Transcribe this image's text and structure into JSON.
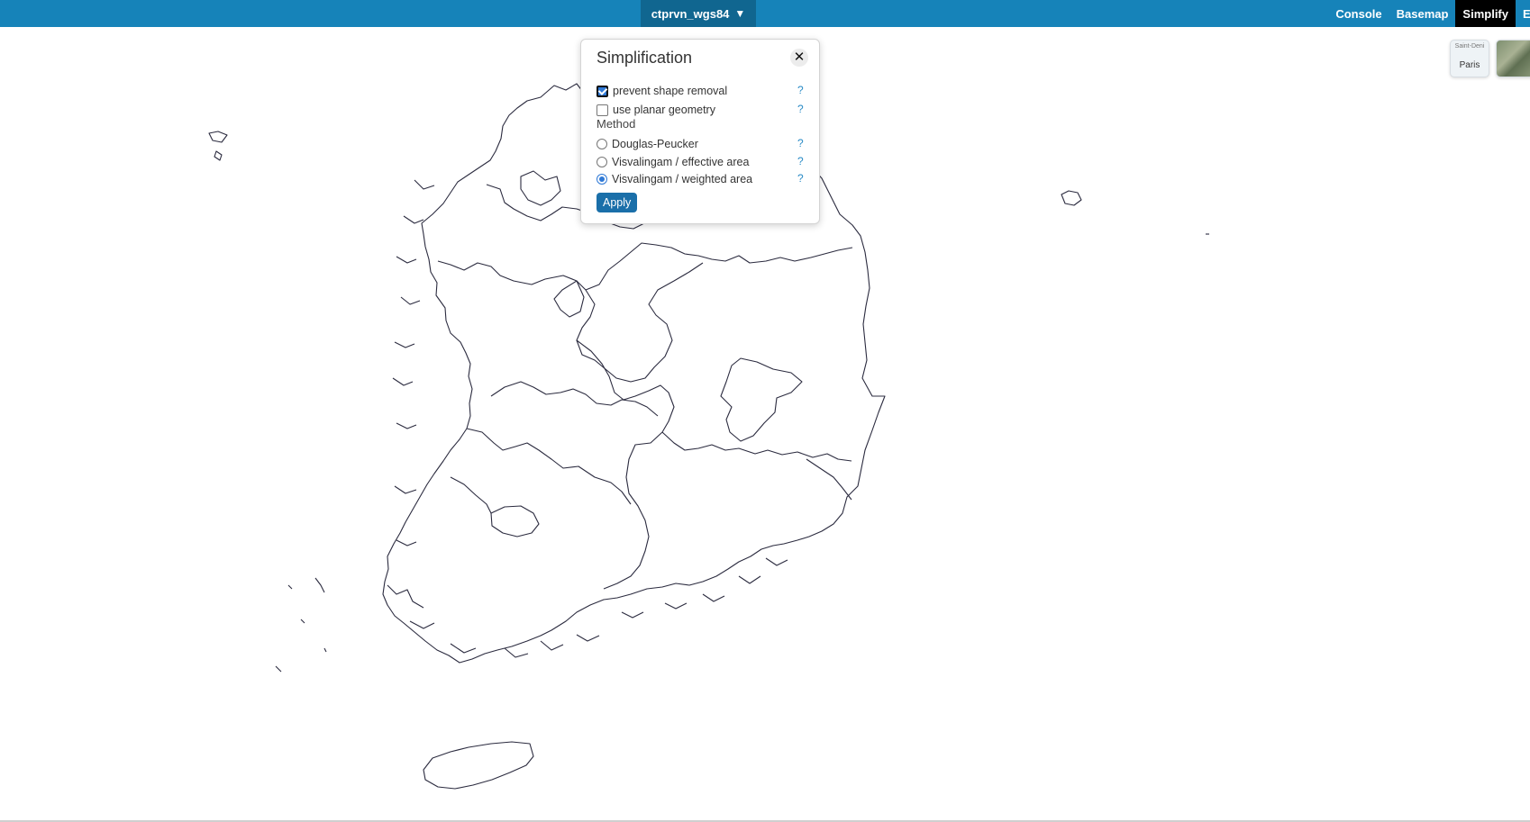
{
  "topbar": {
    "layer_name": "ctprvn_wgs84",
    "layer_caret": "▼",
    "menu": [
      {
        "label": "Console",
        "active": false
      },
      {
        "label": "Basemap",
        "active": false
      },
      {
        "label": "Simplify",
        "active": true
      },
      {
        "label": "E",
        "active": false
      }
    ]
  },
  "basemap_thumbs": {
    "street_small": "Saint-Deni",
    "street_label": "Paris"
  },
  "simplification": {
    "title": "Simplification",
    "close_glyph": "✕",
    "options": [
      {
        "label": "prevent shape removal",
        "checked": true,
        "help": "?"
      },
      {
        "label": "use planar geometry",
        "checked": false,
        "help": "?"
      }
    ],
    "method_label": "Method",
    "methods": [
      {
        "label": "Douglas-Peucker",
        "selected": false,
        "help": "?"
      },
      {
        "label": "Visvalingam / effective area",
        "selected": false,
        "help": "?"
      },
      {
        "label": "Visvalingam / weighted area",
        "selected": true,
        "help": "?"
      }
    ],
    "apply_label": "Apply"
  },
  "colors": {
    "topbar": "#1683b9",
    "layer_select": "#106690",
    "outline": "#2b2b3f",
    "accent": "#1a6fa9"
  }
}
